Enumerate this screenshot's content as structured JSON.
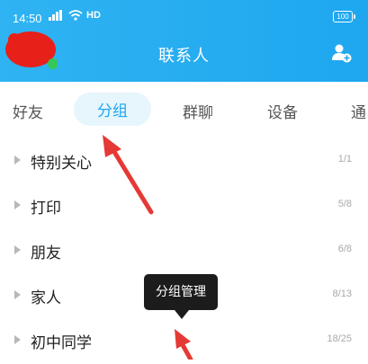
{
  "status_bar": {
    "time": "14:50",
    "network": "HD",
    "battery": "100"
  },
  "header": {
    "title": "联系人"
  },
  "tabs": [
    {
      "label": "好友"
    },
    {
      "label": "分组"
    },
    {
      "label": "群聊"
    },
    {
      "label": "设备"
    },
    {
      "label": "通"
    }
  ],
  "groups": [
    {
      "name": "特别关心",
      "count": "1/1"
    },
    {
      "name": "打印",
      "count": "5/8"
    },
    {
      "name": "朋友",
      "count": "6/8"
    },
    {
      "name": "家人",
      "count": "8/13"
    },
    {
      "name": "初中同学",
      "count": "18/25"
    }
  ],
  "tooltip": {
    "label": "分组管理"
  },
  "colors": {
    "header": "#1ea7ef",
    "accent": "#1ea7ef",
    "annotation": "#e53935"
  }
}
